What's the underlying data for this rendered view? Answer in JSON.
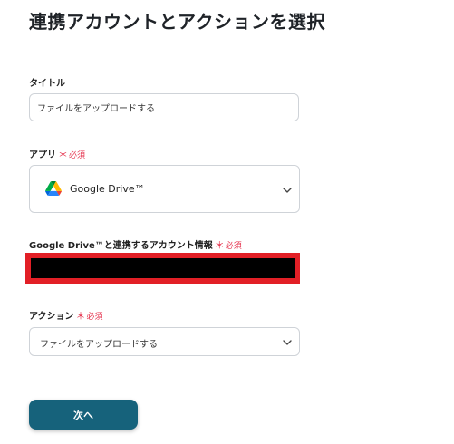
{
  "page": {
    "title": "連携アカウントとアクションを選択"
  },
  "fields": {
    "title_field": {
      "label": "タイトル",
      "value": "ファイルをアップロードする"
    },
    "app_field": {
      "label": "アプリ",
      "required_mark": "＊",
      "required_text": "必須",
      "selected_app": "Google Drive™",
      "icon": "google-drive-icon"
    },
    "account_field": {
      "label": "Google Drive™と連携するアカウント情報",
      "required_mark": "＊",
      "required_text": "必須"
    },
    "action_field": {
      "label": "アクション",
      "required_mark": "＊",
      "required_text": "必須",
      "selected_action": "ファイルをアップロードする"
    }
  },
  "buttons": {
    "next_label": "次へ"
  },
  "colors": {
    "primary": "#16627b",
    "required": "#e5314c",
    "highlight_border": "#e21f26"
  }
}
